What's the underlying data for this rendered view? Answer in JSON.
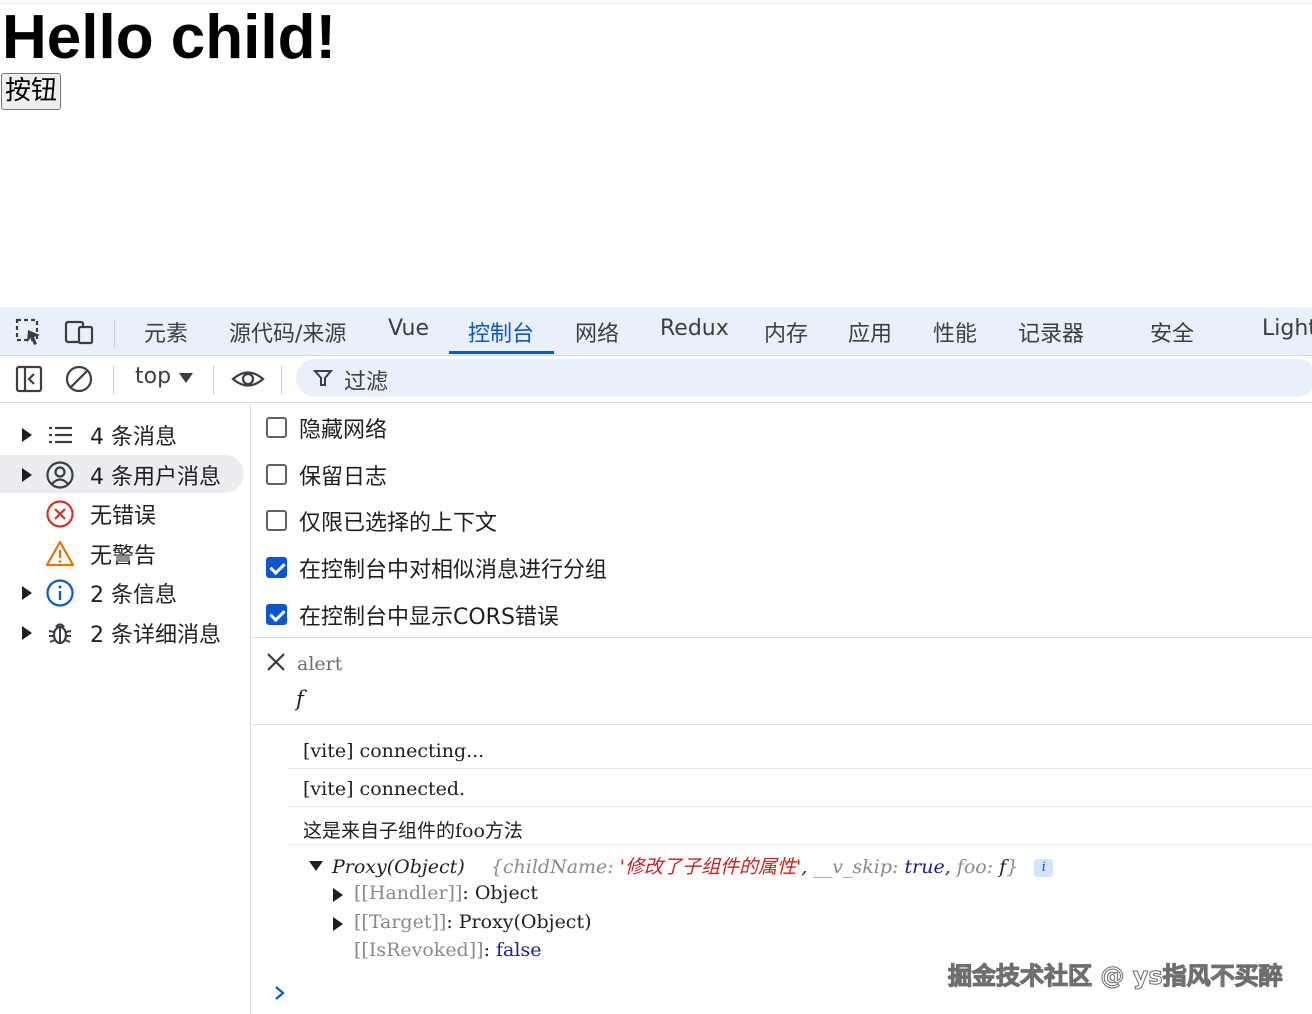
{
  "page": {
    "heading": "Hello child!",
    "button_label": "按钮"
  },
  "devtools": {
    "tabs": [
      {
        "label": "元素"
      },
      {
        "label": "源代码/来源"
      },
      {
        "label": "Vue"
      },
      {
        "label": "控制台",
        "active": true
      },
      {
        "label": "网络"
      },
      {
        "label": "Redux"
      },
      {
        "label": "内存"
      },
      {
        "label": "应用"
      },
      {
        "label": "性能"
      },
      {
        "label": "记录器"
      },
      {
        "label": "安全"
      },
      {
        "label": "Light"
      }
    ],
    "toolbar": {
      "context": "top",
      "filter_placeholder": "过滤"
    },
    "sidebar": [
      {
        "label": "4 条消息",
        "icon": "list-icon",
        "expandable": true
      },
      {
        "label": "4 条用户消息",
        "icon": "user-icon",
        "expandable": true,
        "selected": true
      },
      {
        "label": "无错误",
        "icon": "error-icon",
        "expandable": false
      },
      {
        "label": "无警告",
        "icon": "warning-icon",
        "expandable": false
      },
      {
        "label": "2 条信息",
        "icon": "info-icon",
        "expandable": true
      },
      {
        "label": "2 条详细消息",
        "icon": "bug-icon",
        "expandable": true
      }
    ],
    "settings": [
      {
        "label": "隐藏网络",
        "checked": false
      },
      {
        "label": "保留日志",
        "checked": false
      },
      {
        "label": "仅限已选择的上下文",
        "checked": false
      },
      {
        "label": "在控制台中对相似消息进行分组",
        "checked": true
      },
      {
        "label": "在控制台中显示CORS错误",
        "checked": true
      }
    ],
    "live_expression": {
      "expression": "alert",
      "result": "f"
    },
    "messages": [
      "[vite] connecting...",
      "[vite] connected.",
      "这是来自子组件的foo方法"
    ],
    "object": {
      "summary_type": "Proxy(Object)",
      "preview_open": "{",
      "k1": "childName",
      "v1": "'修改了子组件的属性'",
      "k2": "__v_skip",
      "v2": "true",
      "k3": "foo",
      "v3": "f",
      "preview_close": "}",
      "info_badge": "i",
      "handler_key": "[[Handler]]",
      "handler_val": "Object",
      "target_key": "[[Target]]",
      "target_val": "Proxy(Object)",
      "revoked_key": "[[IsRevoked]]",
      "revoked_val": "false"
    }
  },
  "watermark": "掘金技术社区 @ ys指风不买醉",
  "colors": {
    "accent": "#0b57d0",
    "tabbar_bg": "#eaf0f9",
    "string": "#c5221f",
    "keyword": "#1a1aa6",
    "error": "#d93025",
    "warning": "#e37400"
  }
}
